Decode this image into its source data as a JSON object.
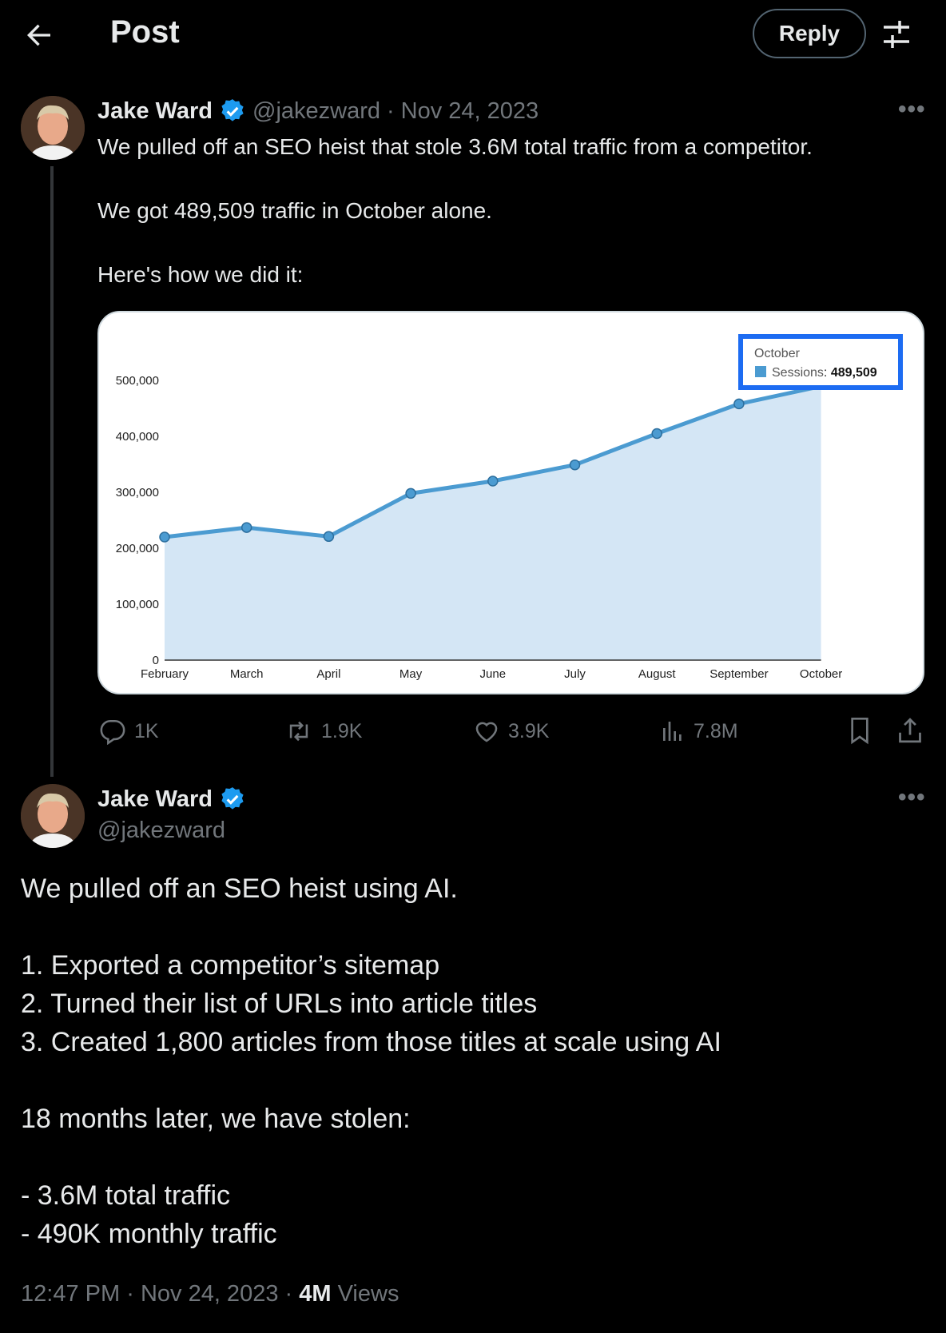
{
  "header": {
    "title": "Post",
    "reply_label": "Reply"
  },
  "first_post": {
    "name": "Jake Ward",
    "handle": "@jakezward",
    "separator": "·",
    "date": "Nov 24, 2023",
    "line1": "We pulled off an SEO heist that stole 3.6M total traffic from a competitor.",
    "line2": "We got 489,509 traffic in October alone.",
    "line3": "Here's how we did it:",
    "actions": {
      "replies": "1K",
      "reposts": "1.9K",
      "likes": "3.9K",
      "views": "7.8M"
    }
  },
  "second_post": {
    "name": "Jake Ward",
    "handle": "@jakezward",
    "body": "We pulled off an SEO heist using AI.\n\n1. Exported a competitor’s sitemap\n2. Turned their list of URLs into article titles\n3. Created 1,800 articles from those titles at scale using AI\n\n18 months later, we have stolen:\n\n- 3.6M total traffic\n- 490K monthly traffic",
    "time": "12:47 PM",
    "sep1": "·",
    "date": "Nov 24, 2023",
    "sep2": "·",
    "views_count": "4M",
    "views_label": "Views"
  },
  "chart_data": {
    "type": "area",
    "categories": [
      "February",
      "March",
      "April",
      "May",
      "June",
      "July",
      "August",
      "September",
      "October"
    ],
    "series": [
      {
        "name": "Sessions",
        "values": [
          220000,
          237000,
          221000,
          298000,
          320000,
          349000,
          405000,
          458000,
          489509
        ]
      }
    ],
    "yticks": [
      "0",
      "100,000",
      "200,000",
      "300,000",
      "400,000",
      "500,000"
    ],
    "ylim": [
      0,
      500000
    ],
    "grid": false,
    "tooltip": {
      "title": "October",
      "label": "Sessions",
      "value": "489,509"
    },
    "colors": {
      "line": "#4b9bd1",
      "fill": "#d4e6f5",
      "highlight": "#1d6cf2"
    }
  },
  "colors": {
    "verified": "#1d9bf0",
    "muted": "#71767b"
  }
}
